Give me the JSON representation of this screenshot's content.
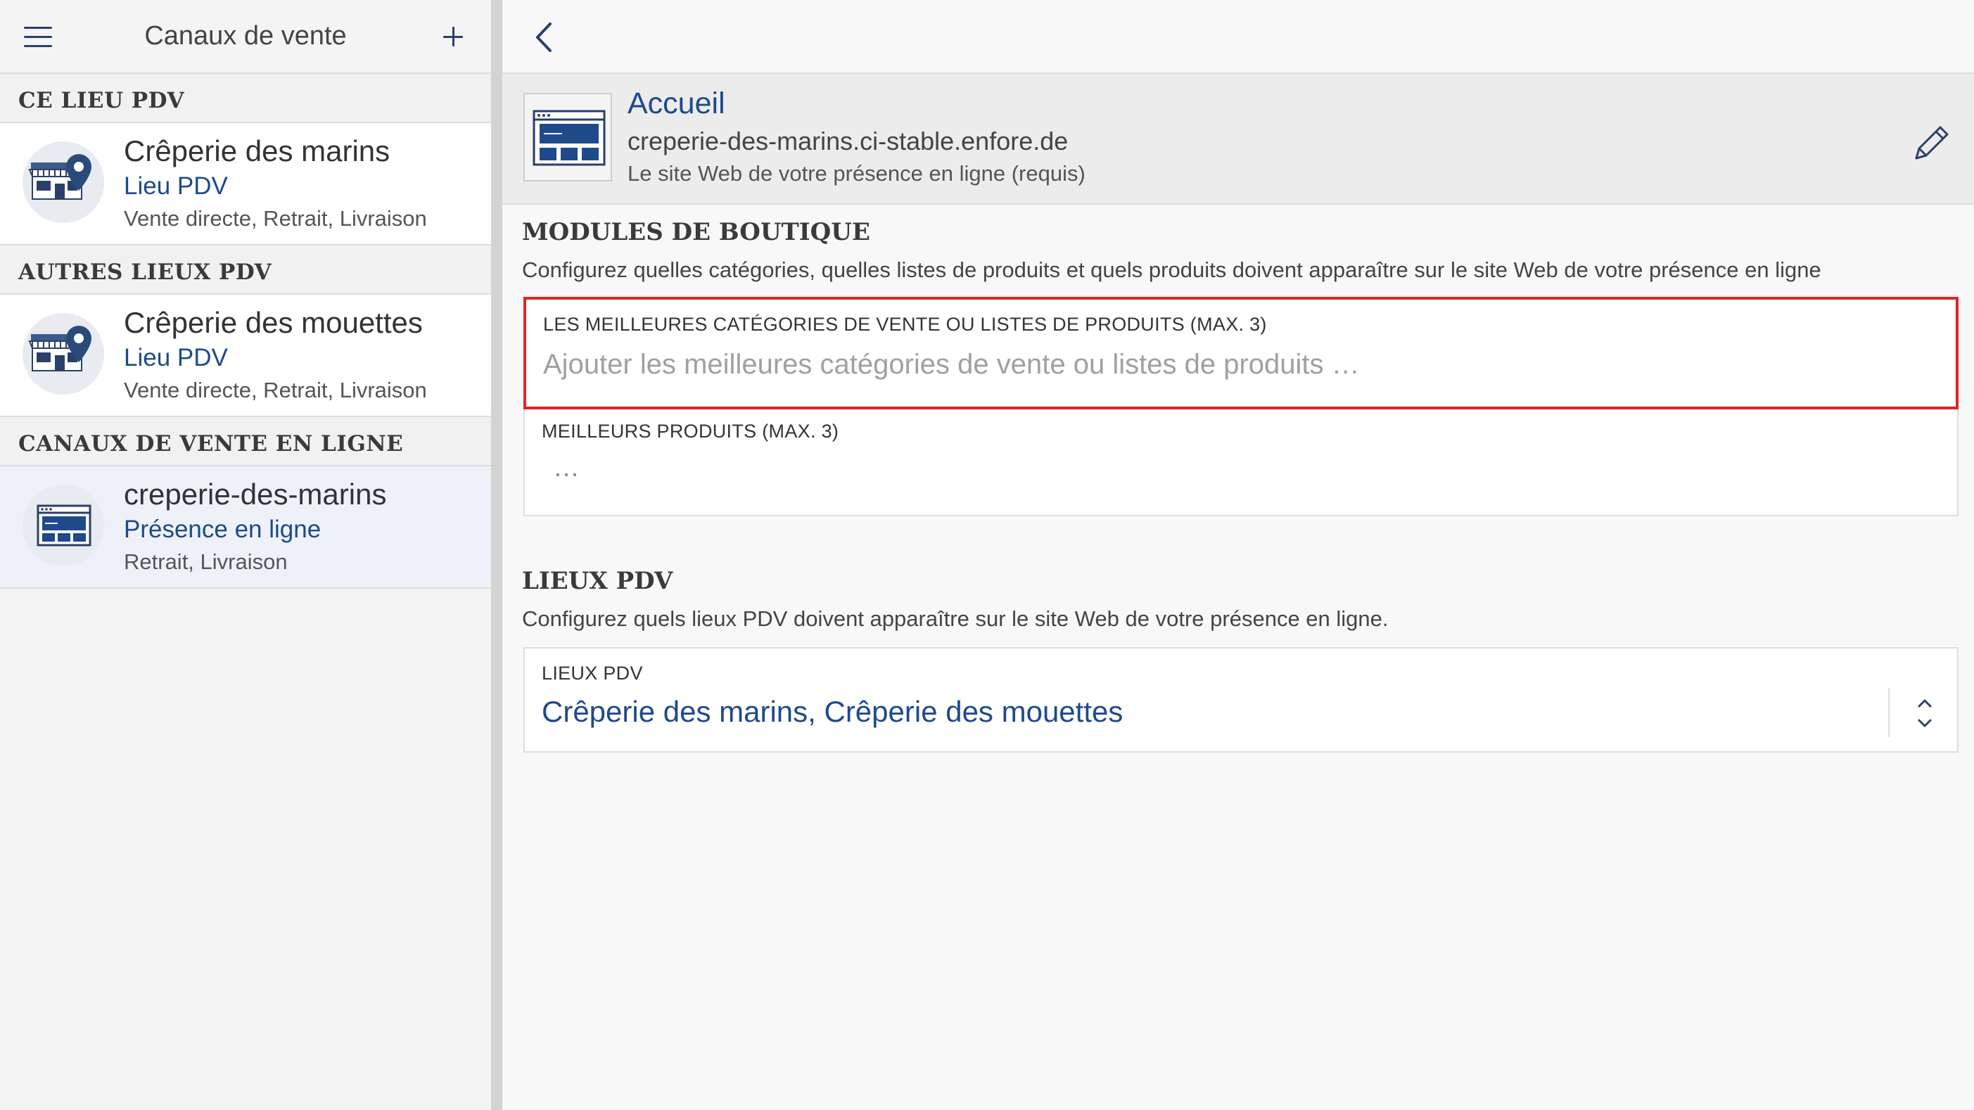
{
  "sidebar": {
    "title": "Canaux de vente",
    "sections": [
      {
        "heading": "CE LIEU PDV",
        "channels": [
          {
            "name": "Crêperie des marins",
            "type": "Lieu PDV",
            "modes": "Vente directe, Retrait, Livraison",
            "icon": "store-location-icon",
            "selected": false
          }
        ]
      },
      {
        "heading": "AUTRES LIEUX PDV",
        "channels": [
          {
            "name": "Crêperie des mouettes",
            "type": "Lieu PDV",
            "modes": "Vente directe, Retrait, Livraison",
            "icon": "store-location-icon",
            "selected": false
          }
        ]
      },
      {
        "heading": "CANAUX DE VENTE EN LIGNE",
        "channels": [
          {
            "name": "creperie-des-marins",
            "type": "Présence en ligne",
            "modes": "Retrait, Livraison",
            "icon": "website-icon",
            "selected": true
          }
        ]
      }
    ]
  },
  "detail": {
    "title": "Accueil",
    "url": "creperie-des-marins.ci-stable.enfore.de",
    "description": "Le site Web de votre présence en ligne (requis)"
  },
  "shop_modules": {
    "title": "MODULES DE BOUTIQUE",
    "subtitle": "Configurez quelles catégories, quelles listes de produits et quels produits doivent apparaître sur le site Web de votre présence en ligne",
    "top_categories": {
      "label": "LES MEILLEURES CATÉGORIES DE VENTE OU LISTES DE PRODUITS (MAX. 3)",
      "placeholder": "Ajouter les meilleures catégories de vente ou listes de produits …"
    },
    "top_products": {
      "label": "MEILLEURS PRODUITS (MAX. 3)",
      "placeholder": "…"
    }
  },
  "pos_locations": {
    "title": "LIEUX PDV",
    "subtitle": "Configurez quels lieux PDV doivent apparaître sur le site Web de votre présence en ligne.",
    "field": {
      "label": "LIEUX PDV",
      "value": "Crêperie des marins, Crêperie des mouettes"
    }
  },
  "colors": {
    "accent": "#1e4a8a",
    "highlight_border": "#e02424",
    "selected_row": "#eef2f8"
  }
}
